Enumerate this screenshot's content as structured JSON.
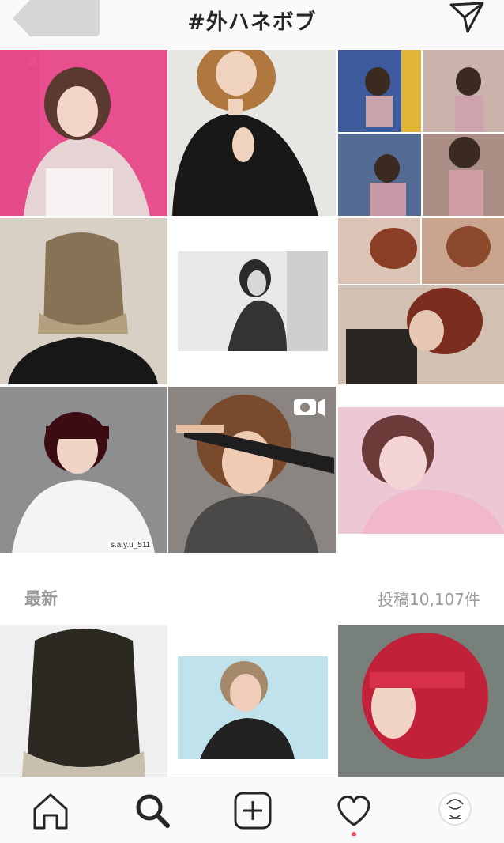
{
  "header": {
    "title": "#外ハネボブ"
  },
  "top_posts": [
    {
      "subject": "portrait-pink-background"
    },
    {
      "subject": "bob-black-sweater"
    },
    {
      "subject": "collage-street-poses"
    },
    {
      "subject": "back-of-head-bob"
    },
    {
      "subject": "monochrome-portrait"
    },
    {
      "subject": "collage-brown-bob"
    },
    {
      "subject": "dark-red-bob-white-blouse",
      "repost_credit": "s.a.y.u_511"
    },
    {
      "subject": "hair-iron-styling",
      "badge": "video-icon"
    },
    {
      "subject": "pink-sweater-bob"
    }
  ],
  "recent_section": {
    "title": "最新",
    "count_label": "投稿10,107件"
  },
  "recent_posts": [
    {
      "subject": "dark-bob-back-view"
    },
    {
      "subject": "framed-blonde-bob"
    },
    {
      "subject": "red-hair-bob"
    }
  ],
  "tab_bar": {
    "items": [
      "home-icon",
      "search-icon",
      "add-icon",
      "heart-icon",
      "profile-avatar"
    ],
    "active": "search-icon",
    "notification_color": "#ed4956"
  }
}
